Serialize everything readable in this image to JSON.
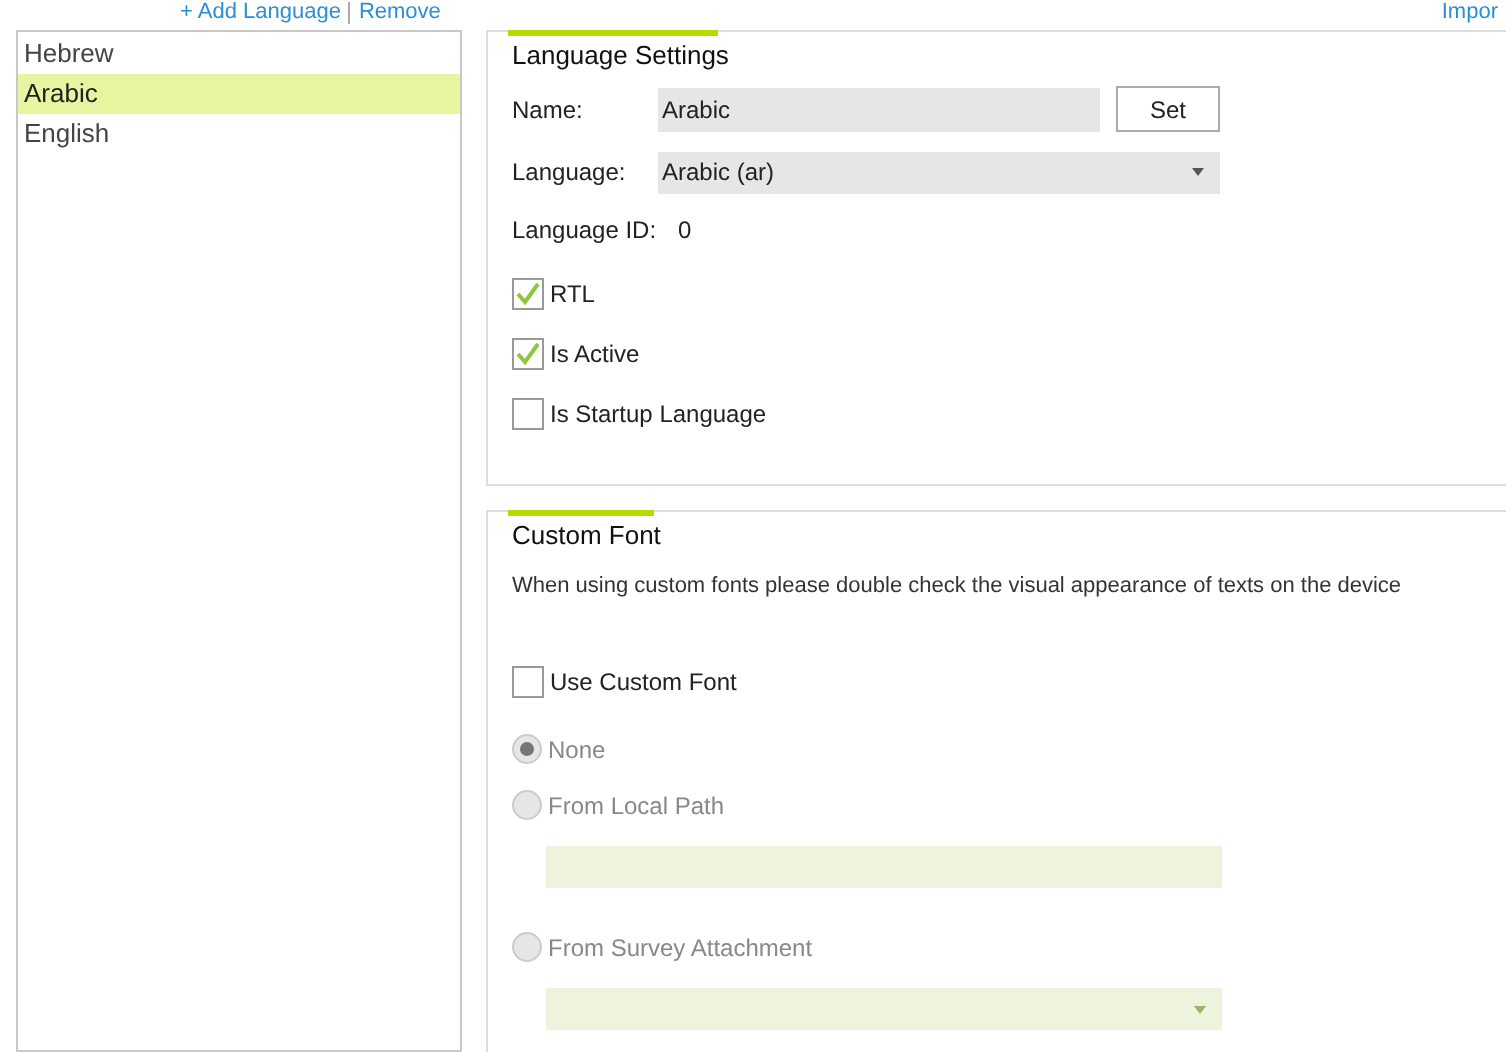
{
  "toolbar": {
    "add_link": "+ Add Language",
    "remove_link": "Remove",
    "import_link": "Impor"
  },
  "languages": [
    {
      "label": "Hebrew",
      "selected": false
    },
    {
      "label": "Arabic",
      "selected": true
    },
    {
      "label": "English",
      "selected": false
    }
  ],
  "language_settings": {
    "title": "Language Settings",
    "name_label": "Name:",
    "name_value": "Arabic",
    "set_button": "Set",
    "language_label": "Language:",
    "language_value": "Arabic (ar)",
    "id_label": "Language ID:",
    "id_value": "0",
    "options": [
      {
        "label": "RTL",
        "checked": true
      },
      {
        "label": "Is Active",
        "checked": true
      },
      {
        "label": "Is Startup Language",
        "checked": false
      }
    ]
  },
  "custom_font": {
    "title": "Custom Font",
    "note": "When using custom fonts please double check the visual appearance of texts on the device",
    "use_label": "Use Custom Font",
    "use_checked": false,
    "sources": [
      {
        "label": "None",
        "selected": true,
        "kind": "plain"
      },
      {
        "label": "From Local Path",
        "selected": false,
        "kind": "path"
      },
      {
        "label": "From Survey Attachment",
        "selected": false,
        "kind": "attachment"
      }
    ]
  }
}
